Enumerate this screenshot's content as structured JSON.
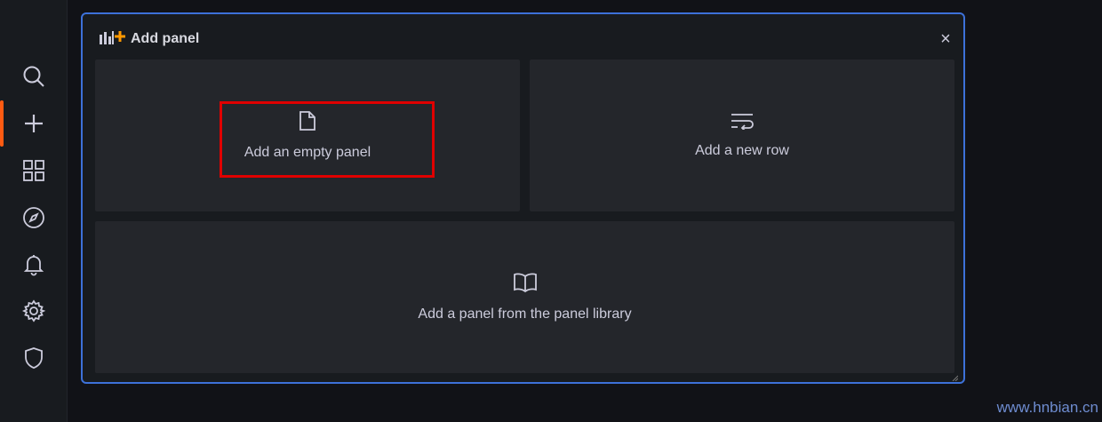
{
  "sidebar": {
    "items": [
      {
        "icon": "search-icon"
      },
      {
        "icon": "plus-icon",
        "active": true
      },
      {
        "icon": "dashboards-grid-icon"
      },
      {
        "icon": "compass-icon"
      },
      {
        "icon": "bell-icon"
      },
      {
        "icon": "gear-icon"
      },
      {
        "icon": "shield-icon"
      }
    ],
    "active_color": "#ff5b12"
  },
  "panel": {
    "title": "Add panel",
    "close_label": "×",
    "border_color": "#3d71d9",
    "options": {
      "empty_panel": "Add an empty panel",
      "new_row": "Add a new row",
      "library": "Add a panel from the panel library"
    }
  },
  "watermark": "www.hnbian.cn"
}
